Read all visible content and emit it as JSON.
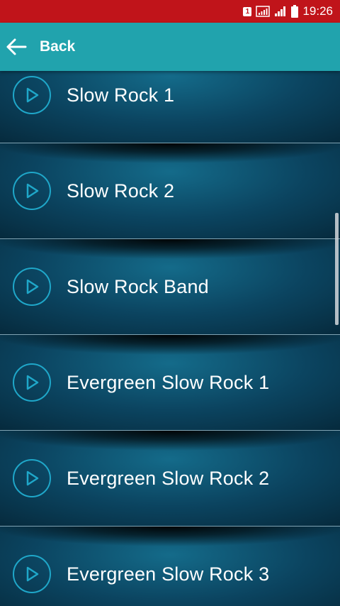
{
  "status_bar": {
    "sim_label": "1",
    "time": "19:26"
  },
  "toolbar": {
    "back_label": "Back"
  },
  "list": {
    "items": [
      {
        "label": "Slow Rock 1"
      },
      {
        "label": "Slow Rock 2"
      },
      {
        "label": "Slow Rock Band"
      },
      {
        "label": "Evergreen Slow Rock 1"
      },
      {
        "label": "Evergreen Slow Rock 2"
      },
      {
        "label": "Evergreen Slow Rock 3"
      }
    ]
  },
  "colors": {
    "status_bar": "#c0141a",
    "toolbar": "#21a3ad",
    "play_icon": "#1fa7c9",
    "item_text": "#ffffff",
    "divider": "#7fa3b3"
  },
  "icons": {
    "back": "arrow-left-icon",
    "play": "play-circle-icon",
    "signal": "signal-icon",
    "battery": "battery-icon"
  }
}
